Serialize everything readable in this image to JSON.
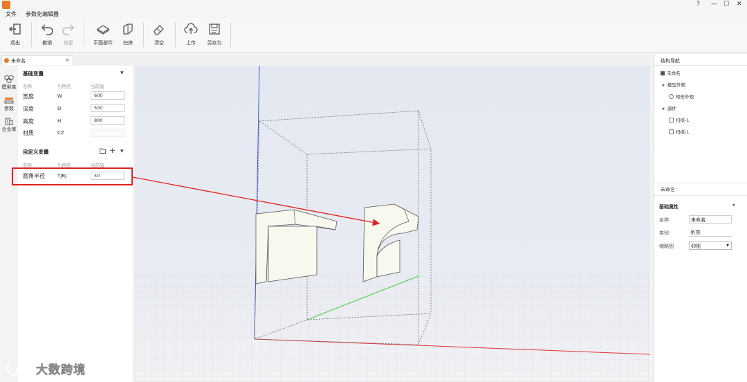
{
  "menubar": {
    "file": "文件",
    "active_tab": "参数化编辑器"
  },
  "toolbar": {
    "exit": "退出",
    "undo": "撤销",
    "redo": "恢复",
    "planar_part": "平面部件",
    "sweep": "扫掠",
    "clear": "清空",
    "upload": "上传",
    "save_as": "另存为"
  },
  "doc_tab": {
    "label": "未命名"
  },
  "rail": {
    "model_lib": "模型库",
    "params": "参数",
    "enterprise_lib": "企业库"
  },
  "basic_vars": {
    "title": "基础变量",
    "headers": {
      "name": "名称",
      "ref": "引用名",
      "value": "当前值"
    },
    "rows": [
      {
        "name": "宽度",
        "ref": "W",
        "value": "600"
      },
      {
        "name": "深度",
        "ref": "D",
        "value": "500"
      },
      {
        "name": "高度",
        "ref": "H",
        "value": "800"
      },
      {
        "name": "材质",
        "ref": "CZ",
        "value": ""
      }
    ]
  },
  "custom_vars": {
    "title": "自定义变量",
    "headers": {
      "name": "名称",
      "ref": "引用名",
      "value": "当前值"
    },
    "rows": [
      {
        "name": "圆角半径",
        "ref": "YJBJ",
        "value": "50"
      }
    ]
  },
  "struct_nav": {
    "title": "结构导航",
    "root": "未命名",
    "group1": "模型外观",
    "group1_item": "矩形外观",
    "group2": "部件",
    "group2_items": [
      "扫掠-1",
      "扫掠-1"
    ]
  },
  "props": {
    "panel_title": "未命名",
    "section": "基础属性",
    "name_label": "名称",
    "name_value": "未命名",
    "category_label": "类别",
    "category_value": "吊顶",
    "thumb_label": "缩略图",
    "thumb_value": "仰视"
  },
  "watermark": "大数跨境",
  "colors": {
    "accent": "#e8792b",
    "highlight": "#e02020",
    "axis_blue": "#4455dd",
    "axis_green": "#44cc44",
    "axis_red": "#dd3333"
  }
}
